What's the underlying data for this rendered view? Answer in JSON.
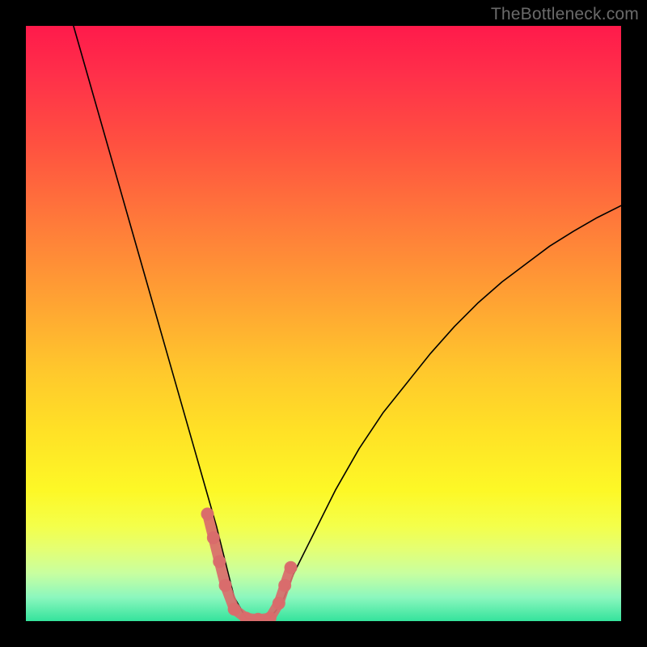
{
  "watermark": "TheBottleneck.com",
  "chart_data": {
    "type": "line",
    "title": "",
    "xlabel": "",
    "ylabel": "",
    "xlim": [
      0,
      100
    ],
    "ylim": [
      0,
      100
    ],
    "grid": false,
    "legend": false,
    "series": [
      {
        "name": "bottleneck-curve",
        "x": [
          8,
          10,
          12,
          14,
          16,
          18,
          20,
          22,
          24,
          26,
          28,
          30,
          32,
          33.5,
          35,
          37,
          39,
          41,
          43,
          45,
          48,
          52,
          56,
          60,
          64,
          68,
          72,
          76,
          80,
          84,
          88,
          92,
          96,
          100
        ],
        "values": [
          100,
          93,
          86,
          79,
          72,
          65,
          58,
          51,
          44,
          37,
          30,
          23,
          16,
          10,
          4,
          0.5,
          0.3,
          0.5,
          3,
          8,
          14,
          22,
          29,
          35,
          40,
          45,
          49.5,
          53.5,
          57,
          60,
          63,
          65.5,
          67.8,
          69.8
        ],
        "color": "#000000"
      },
      {
        "name": "highlight-region",
        "x": [
          30.5,
          31.5,
          32.5,
          33.5,
          35,
          37,
          39,
          41,
          42.5,
          43.5,
          44.5
        ],
        "values": [
          18,
          14,
          10,
          6,
          2,
          0.5,
          0.3,
          0.5,
          3,
          6,
          9
        ],
        "color": "#d96b6b"
      }
    ],
    "annotations": []
  }
}
